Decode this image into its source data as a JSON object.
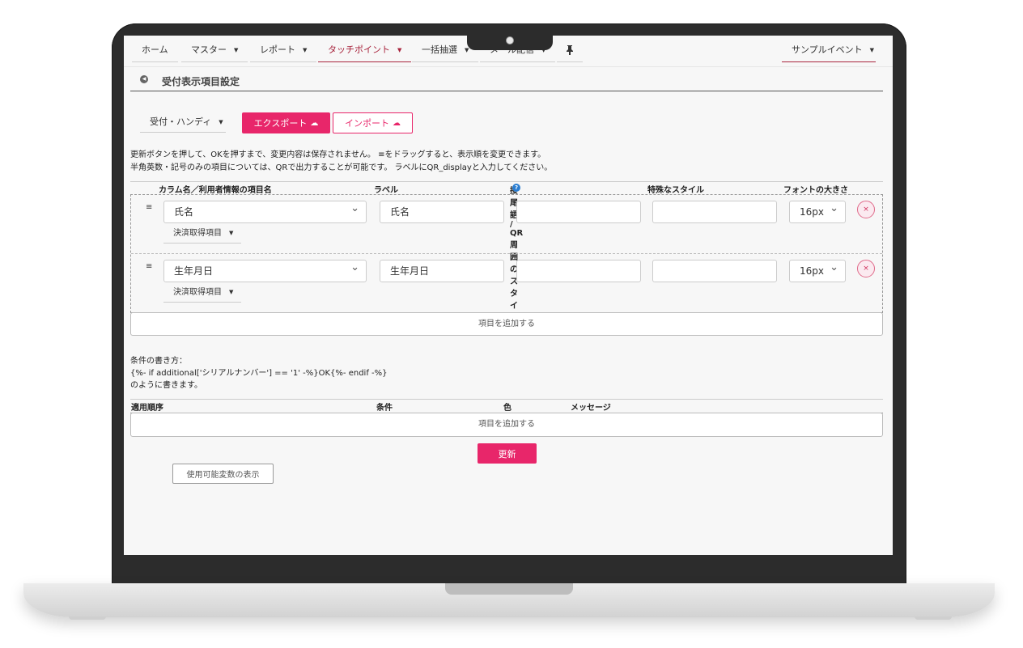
{
  "nav": {
    "items": [
      {
        "label": "ホーム",
        "has_caret": false
      },
      {
        "label": "マスター",
        "has_caret": true
      },
      {
        "label": "レポート",
        "has_caret": true
      },
      {
        "label": "タッチポイント",
        "has_caret": true
      },
      {
        "label": "一括抽選",
        "has_caret": true
      },
      {
        "label": "メール配信",
        "has_caret": true
      }
    ],
    "pin_icon": "pin-icon",
    "event_selector": "サンプルイベント",
    "active_color": "#a8243d"
  },
  "page": {
    "title": "受付表示項目設定",
    "back_icon": "back-circle-icon"
  },
  "toolbar": {
    "device_select": "受付・ハンディ",
    "export_label": "エクスポート",
    "import_label": "インポート",
    "cloud_icon": "cloud-icon",
    "accent_color": "#e8266a"
  },
  "notes": [
    "更新ボタンを押して、OKを押すまで、変更内容は保存されません。 ≡をドラッグすると、表示順を変更できます。",
    "半角英数・記号のみの項目については、QRで出力することが可能です。 ラベルにQR_displayと入力してください。"
  ],
  "columns": {
    "column_name": "カラム名／利用者情報の項目名",
    "label": "ラベル",
    "suffix": "接尾語 / QR周囲のスタイル",
    "special": "特殊なスタイル",
    "font_size": "フォントの大きさ"
  },
  "rows": [
    {
      "handle": "≡",
      "column": "氏名",
      "label": "氏名",
      "suffix": "",
      "special": "",
      "font_size": "16px",
      "sub_select": "決済取得項目",
      "remove": "×"
    },
    {
      "handle": "≡",
      "column": "生年月日",
      "label": "生年月日",
      "suffix": "",
      "special": "",
      "font_size": "16px",
      "sub_select": "決済取得項目",
      "remove": "×"
    }
  ],
  "add_item_label": "項目を追加する",
  "conditions": {
    "notes": [
      "条件の書き方：",
      "{%- if additional['シリアルナンバー'] == '1' -%}OK{%- endif -%}",
      "のように書きます。"
    ],
    "headers": {
      "order": "適用順序",
      "condition": "条件",
      "color": "色",
      "message": "メッセージ"
    },
    "add_label": "項目を追加する"
  },
  "update_label": "更新",
  "vars_label": "使用可能変数の表示"
}
